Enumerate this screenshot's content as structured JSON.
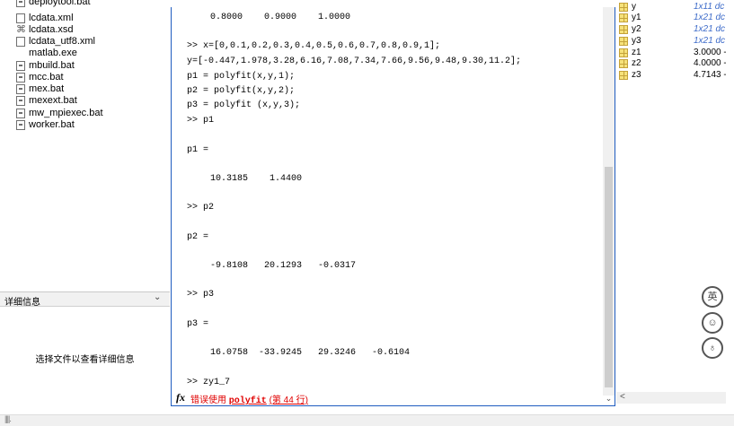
{
  "file_browser": {
    "items": [
      {
        "label": "deploytool.bat",
        "icon": "bat-file-icon"
      },
      {
        "label": "lcdata.xml",
        "icon": "xml-file-icon"
      },
      {
        "label": "lcdata.xsd",
        "icon": "xsd-file-icon"
      },
      {
        "label": "lcdata_utf8.xml",
        "icon": "xml-file-icon"
      },
      {
        "label": "matlab.exe",
        "icon": "matlab-exe-icon"
      },
      {
        "label": "mbuild.bat",
        "icon": "bat-file-icon"
      },
      {
        "label": "mcc.bat",
        "icon": "bat-file-icon"
      },
      {
        "label": "mex.bat",
        "icon": "bat-file-icon"
      },
      {
        "label": "mexext.bat",
        "icon": "bat-file-icon"
      },
      {
        "label": "mw_mpiexec.bat",
        "icon": "bat-file-icon"
      },
      {
        "label": "worker.bat",
        "icon": "bat-file-icon"
      }
    ]
  },
  "details": {
    "title": "详细信息",
    "chevron": "⌄",
    "hint": "选择文件以查看详细信息"
  },
  "command_window": {
    "lines": [
      {
        "text": "0.8000    0.9000    1.0000",
        "kind": "out"
      },
      {
        "text": ">> x=[0,0.1,0.2,0.3,0.4,0.5,0.6,0.7,0.8,0.9,1];",
        "kind": "in"
      },
      {
        "text": "y=[-0.447,1.978,3.28,6.16,7.08,7.34,7.66,9.56,9.48,9.30,11.2];",
        "kind": "in"
      },
      {
        "text": "p1 = polyfit(x,y,1);",
        "kind": "in"
      },
      {
        "text": "p2 = polyfit(x,y,2);",
        "kind": "in"
      },
      {
        "text": "p3 = polyfit (x,y,3);",
        "kind": "in"
      },
      {
        "text": ">> p1",
        "kind": "in"
      },
      {
        "text": "p1 =",
        "kind": "in"
      },
      {
        "text": "10.3185    1.4400",
        "kind": "out"
      },
      {
        "text": ">> p2",
        "kind": "in"
      },
      {
        "text": "p2 =",
        "kind": "in"
      },
      {
        "text": "-9.8108   20.1293   -0.0317",
        "kind": "out"
      },
      {
        "text": ">> p3",
        "kind": "in"
      },
      {
        "text": "p3 =",
        "kind": "in"
      },
      {
        "text": "16.0758  -33.9245   29.3246   -0.6104",
        "kind": "out"
      },
      {
        "text": ">> zy1_7",
        "kind": "in"
      }
    ],
    "prompt_symbol": "fx",
    "error": {
      "prefix": "错误使用 ",
      "function": "polyfit",
      "location": "(第 44 行)"
    },
    "scroll_down": "⌄"
  },
  "workspace": {
    "variables": [
      {
        "name": "y",
        "value": "1x11 dc",
        "link": true
      },
      {
        "name": "y1",
        "value": "1x21 dc",
        "link": true
      },
      {
        "name": "y2",
        "value": "1x21 dc",
        "link": true
      },
      {
        "name": "y3",
        "value": "1x21 dc",
        "link": true
      },
      {
        "name": "z1",
        "value": "3.0000 -",
        "link": false
      },
      {
        "name": "z2",
        "value": "4.0000 -",
        "link": false
      },
      {
        "name": "z3",
        "value": "4.7143 -",
        "link": false
      }
    ],
    "scroll_left": "<"
  },
  "float_buttons": [
    {
      "name": "translate-button",
      "label": "英"
    },
    {
      "name": "emoji-button",
      "label": "☺"
    },
    {
      "name": "skin-button",
      "label": "♁"
    }
  ],
  "status_bar": {
    "grip": "||||."
  }
}
